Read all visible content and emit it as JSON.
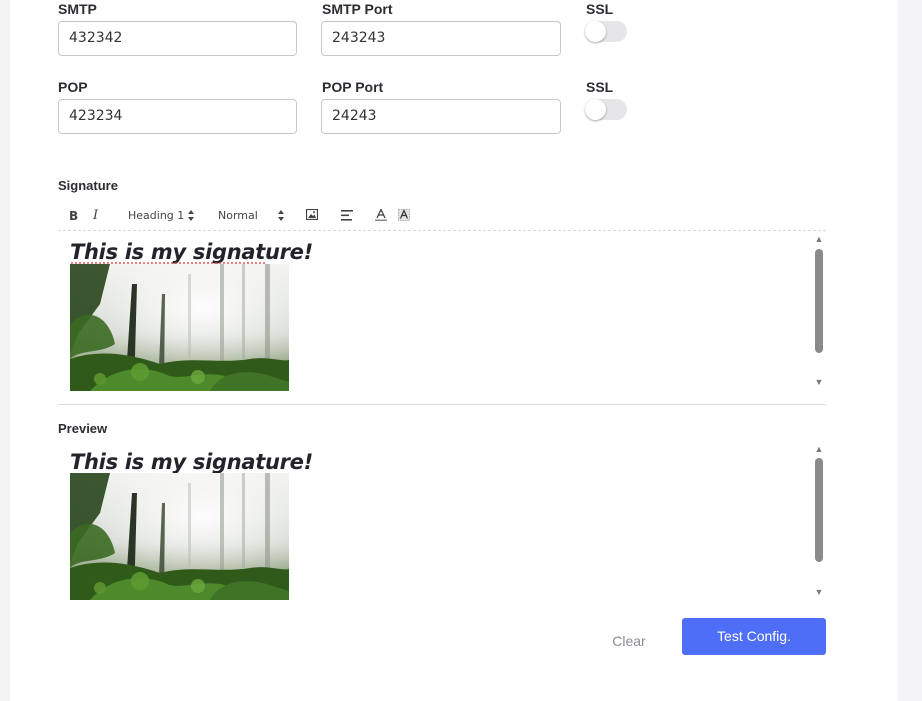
{
  "fields": {
    "smtp_label": "SMTP",
    "smtp_value": "432342",
    "smtp_port_label": "SMTP Port",
    "smtp_port_value": "243243",
    "ssl1_label": "SSL",
    "ssl1_on": false,
    "pop_label": "POP",
    "pop_value": "423234",
    "pop_port_label": "POP Port",
    "pop_port_value": "24243",
    "ssl2_label": "SSL",
    "ssl2_on": false
  },
  "signature": {
    "label": "Signature",
    "toolbar": {
      "bold": "B",
      "italic": "I",
      "header_select": "Heading 1",
      "size_select": "Normal",
      "icons": [
        "image-icon",
        "align-left-icon",
        "text-color-icon",
        "background-color-icon"
      ]
    },
    "text": "This is my signature!"
  },
  "preview": {
    "label": "Preview",
    "text": "This is my signature!"
  },
  "buttons": {
    "clear": "Clear",
    "test": "Test Config."
  },
  "colors": {
    "accent": "#4f6ef7",
    "panel": "#ffffff",
    "background": "#f4f4f6"
  }
}
